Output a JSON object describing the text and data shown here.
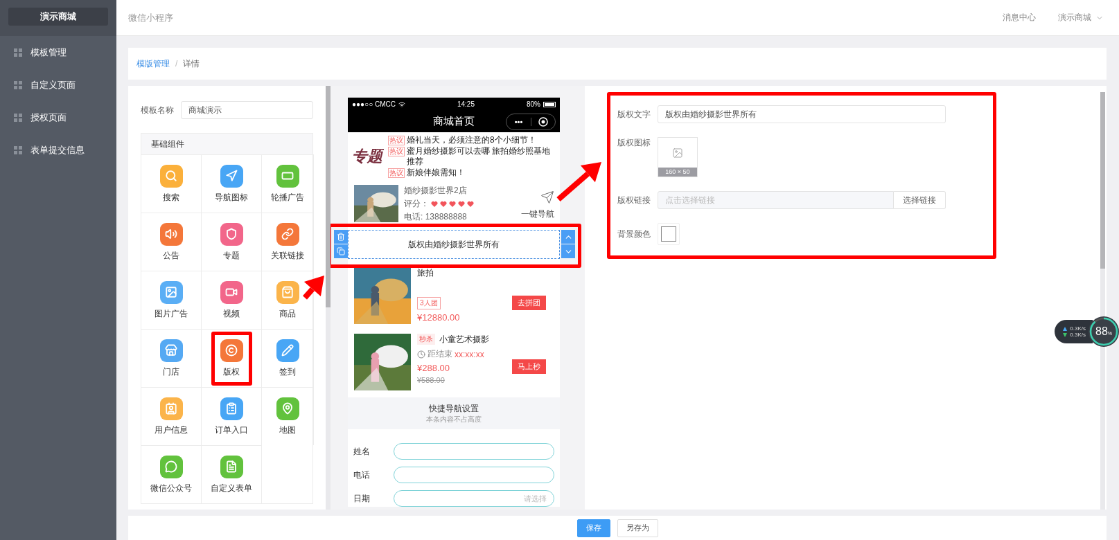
{
  "sidebar": {
    "logo": "演示商城",
    "items": [
      {
        "label": "模板管理"
      },
      {
        "label": "自定义页面"
      },
      {
        "label": "授权页面"
      },
      {
        "label": "表单提交信息"
      }
    ]
  },
  "header": {
    "title": "微信小程序",
    "messages": "消息中心",
    "account": "演示商城"
  },
  "breadcrumb": {
    "items": [
      {
        "label": "模版管理",
        "kind": "link"
      },
      {
        "label": "详情",
        "kind": "current"
      }
    ],
    "separator": "/"
  },
  "template": {
    "label": "模板名称",
    "value": "商城演示"
  },
  "components": {
    "title": "基础组件",
    "items": [
      {
        "label": "搜索",
        "color": "#fbb03b",
        "highlighted": false
      },
      {
        "label": "导航图标",
        "color": "#48a6f5",
        "highlighted": false
      },
      {
        "label": "轮播广告",
        "color": "#62c23d",
        "highlighted": false
      },
      {
        "label": "公告",
        "color": "#f4773a",
        "highlighted": false
      },
      {
        "label": "专题",
        "color": "#f2668a",
        "highlighted": false
      },
      {
        "label": "关联链接",
        "color": "#f4773a",
        "highlighted": false
      },
      {
        "label": "图片广告",
        "color": "#5aaef5",
        "highlighted": false
      },
      {
        "label": "视频",
        "color": "#f2668a",
        "highlighted": false
      },
      {
        "label": "商品",
        "color": "#fbb44a",
        "highlighted": false
      },
      {
        "label": "门店",
        "color": "#55a9f3",
        "highlighted": false
      },
      {
        "label": "版权",
        "color": "#f4773a",
        "highlighted": true
      },
      {
        "label": "签到",
        "color": "#48a6f5",
        "highlighted": false
      },
      {
        "label": "用户信息",
        "color": "#fbb44a",
        "highlighted": false
      },
      {
        "label": "订单入口",
        "color": "#48a6f5",
        "highlighted": false
      },
      {
        "label": "地图",
        "color": "#62c23d",
        "highlighted": false
      },
      {
        "label": "微信公众号",
        "color": "#62c23d",
        "highlighted": false
      },
      {
        "label": "自定义表单",
        "color": "#62c23d",
        "highlighted": false
      }
    ]
  },
  "phone": {
    "status": {
      "carrier": "●●●○○ CMCC",
      "time": "14:25",
      "battery": "80%"
    },
    "title": "商城首页",
    "capsule": "•••",
    "topics": {
      "logo": "专题",
      "items": [
        {
          "tag": "热议",
          "text": "婚礼当天，必须注意的8个小细节！"
        },
        {
          "tag": "热议",
          "text": "蜜月婚纱摄影可以去哪 旅拍婚纱照基地推荐"
        },
        {
          "tag": "热议",
          "text": "新娘伴娘需知！"
        }
      ]
    },
    "store": {
      "name": "婚纱摄影世界2店",
      "rating_label": "评分：",
      "stars": 5,
      "phone": "电话: 138888888",
      "nav": "一键导航"
    },
    "copyright": {
      "text": "版权由婚纱摄影世界所有",
      "selected": true
    },
    "products": [
      {
        "kind": "group",
        "title": "旅拍",
        "tag": "3人团",
        "price": "¥12880.00",
        "action": "去拼团"
      },
      {
        "kind": "seckill",
        "tag": "秒杀",
        "title": "小童艺术摄影",
        "countdown_label": "距结束",
        "countdown": "xx:xx:xx",
        "price": "¥288.00",
        "old_price": "¥588.00",
        "action": "马上秒"
      }
    ],
    "quick_nav": {
      "title": "快捷导航设置",
      "note": "本条内容不占高度"
    },
    "form": [
      {
        "label": "姓名"
      },
      {
        "label": "电话"
      },
      {
        "label": "日期",
        "placeholder": "请选择"
      }
    ]
  },
  "settings": {
    "highlighted": true,
    "text": {
      "label": "版权文字",
      "value": "版权由婚纱摄影世界所有"
    },
    "icon": {
      "label": "版权图标",
      "size": "160 × 50"
    },
    "link": {
      "label": "版权链接",
      "placeholder": "点击选择链接",
      "button": "选择链接"
    },
    "background": {
      "label": "背景颜色",
      "color": "#ffffff"
    }
  },
  "footer": {
    "buttons": [
      {
        "label": "保存",
        "kind": "primary"
      },
      {
        "label": "另存为",
        "kind": "default"
      }
    ]
  },
  "network": {
    "up": "0.3K/s",
    "down": "0.3K/s",
    "value": "88",
    "unit": "%"
  }
}
